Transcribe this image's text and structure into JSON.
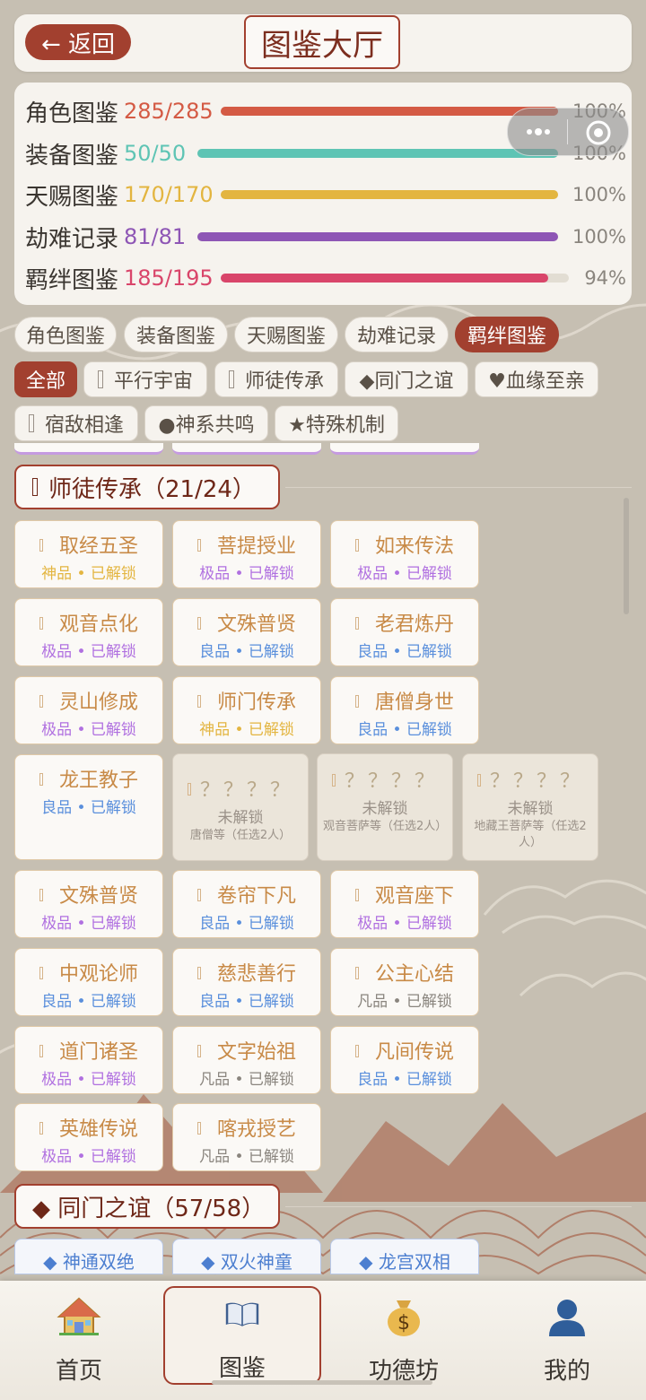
{
  "header": {
    "back_label": "← 返回",
    "title": "图鉴大厅"
  },
  "progress": [
    {
      "label": "角色图鉴",
      "count": "285/285",
      "percent_text": "100%",
      "fill": 1.0,
      "color": "#d45a44"
    },
    {
      "label": "装备图鉴",
      "count": "50/50",
      "percent_text": "100%",
      "fill": 1.0,
      "color": "#5ec4b4"
    },
    {
      "label": "天赐图鉴",
      "count": "170/170",
      "percent_text": "100%",
      "fill": 1.0,
      "color": "#e3b540"
    },
    {
      "label": "劫难记录",
      "count": "81/81",
      "percent_text": "100%",
      "fill": 1.0,
      "color": "#8e56b5"
    },
    {
      "label": "羁绊图鉴",
      "count": "185/195",
      "percent_text": "94%",
      "fill": 0.94,
      "color": "#d9456a"
    }
  ],
  "tabs": [
    "角色图鉴",
    "装备图鉴",
    "天赐图鉴",
    "劫难记录",
    "羁绊图鉴"
  ],
  "filters": [
    "全部",
    "平行宇宙",
    "师徒传承",
    "◆同门之谊",
    "♥血缘至亲",
    "宿敌相逢",
    "●神系共鸣",
    "★特殊机制"
  ],
  "section_mentor": {
    "title": "师徒传承（21/24）",
    "cards": [
      {
        "name": "取经五圣",
        "grade": "神品",
        "status": "已解锁",
        "color": "#e3b540"
      },
      {
        "name": "菩提授业",
        "grade": "极品",
        "status": "已解锁",
        "color": "#b070e0"
      },
      {
        "name": "如来传法",
        "grade": "极品",
        "status": "已解锁",
        "color": "#b070e0"
      },
      {
        "name": "观音点化",
        "grade": "极品",
        "status": "已解锁",
        "color": "#b070e0"
      },
      {
        "name": "文殊普贤",
        "grade": "良品",
        "status": "已解锁",
        "color": "#5a8fdc"
      },
      {
        "name": "老君炼丹",
        "grade": "良品",
        "status": "已解锁",
        "color": "#5a8fdc"
      },
      {
        "name": "灵山修成",
        "grade": "极品",
        "status": "已解锁",
        "color": "#b070e0"
      },
      {
        "name": "师门传承",
        "grade": "神品",
        "status": "已解锁",
        "color": "#e3b540"
      },
      {
        "name": "唐僧身世",
        "grade": "良品",
        "status": "已解锁",
        "color": "#5a8fdc"
      },
      {
        "name": "龙王教子",
        "grade": "良品",
        "status": "已解锁",
        "color": "#5a8fdc"
      },
      {
        "name": "文殊普贤",
        "grade": "极品",
        "status": "已解锁",
        "color": "#b070e0"
      },
      {
        "name": "卷帘下凡",
        "grade": "良品",
        "status": "已解锁",
        "color": "#5a8fdc"
      },
      {
        "name": "观音座下",
        "grade": "极品",
        "status": "已解锁",
        "color": "#b070e0"
      },
      {
        "name": "中观论师",
        "grade": "良品",
        "status": "已解锁",
        "color": "#5a8fdc"
      },
      {
        "name": "慈悲善行",
        "grade": "良品",
        "status": "已解锁",
        "color": "#5a8fdc"
      },
      {
        "name": "公主心结",
        "grade": "凡品",
        "status": "已解锁",
        "color": "#8a857e"
      },
      {
        "name": "道门诸圣",
        "grade": "极品",
        "status": "已解锁",
        "color": "#b070e0"
      },
      {
        "name": "文字始祖",
        "grade": "凡品",
        "status": "已解锁",
        "color": "#8a857e"
      },
      {
        "name": "凡间传说",
        "grade": "良品",
        "status": "已解锁",
        "color": "#5a8fdc"
      },
      {
        "name": "英雄传说",
        "grade": "极品",
        "status": "已解锁",
        "color": "#b070e0"
      },
      {
        "name": "喀戎授艺",
        "grade": "凡品",
        "status": "已解锁",
        "color": "#8a857e"
      }
    ],
    "locked": [
      {
        "name": "？？？？",
        "status": "未解锁",
        "hint": "唐僧等（任选2人）"
      },
      {
        "name": "？？？？",
        "status": "未解锁",
        "hint": "观音菩萨等（任选2人）"
      },
      {
        "name": "？？？？",
        "status": "未解锁",
        "hint": "地藏王菩萨等（任选2人）"
      }
    ]
  },
  "section_fellow": {
    "title": "◆ 同门之谊（57/58）",
    "cards": [
      "◆ 神通双绝",
      "◆ 双火神童",
      "◆ 龙宫双相"
    ]
  },
  "nav": [
    {
      "label": "首页",
      "icon": "house-icon"
    },
    {
      "label": "图鉴",
      "icon": "book-icon"
    },
    {
      "label": "功德坊",
      "icon": "money-bag-icon"
    },
    {
      "label": "我的",
      "icon": "user-icon"
    }
  ]
}
